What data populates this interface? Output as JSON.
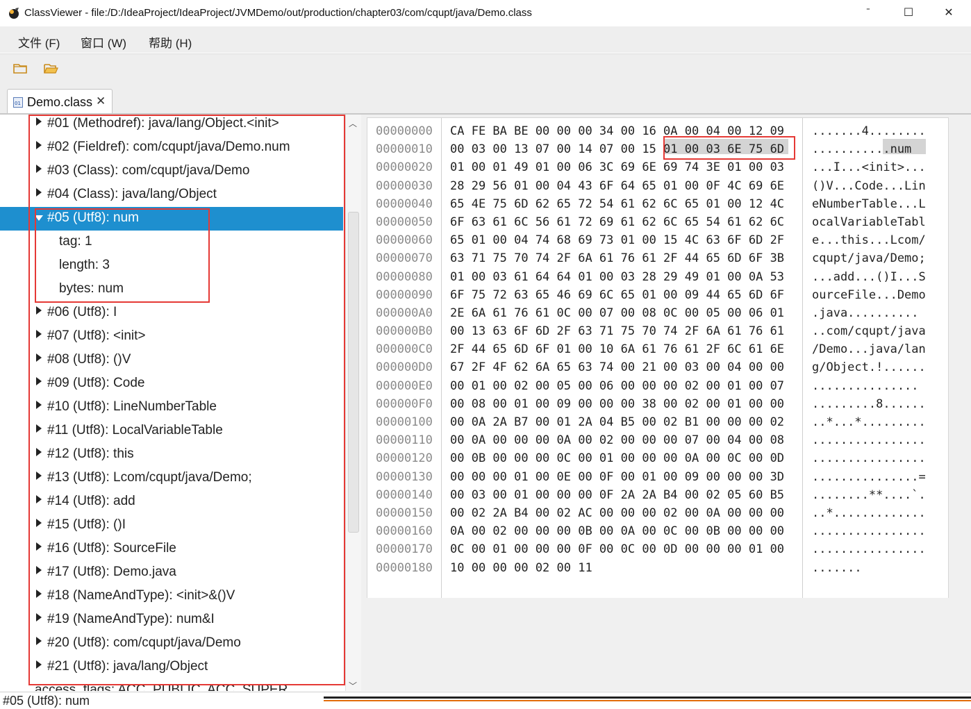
{
  "window": {
    "title": "ClassViewer - file:/D:/IdeaProject/IdeaProject/JVMDemo/out/production/chapter03/com/cqupt/java/Demo.class",
    "minimize": "ˉ",
    "maximize": "☐",
    "close": "✕"
  },
  "menu": [
    "文件 (F)",
    "窗口 (W)",
    "帮助 (H)"
  ],
  "toolbar": {
    "open_icon": "folder-icon",
    "open_recent_icon": "folder-open-icon"
  },
  "tab": {
    "label": "Demo.class",
    "close": "✕"
  },
  "tree": {
    "rows": [
      "#01 (Methodref): java/lang/Object.<init>",
      "#02 (Fieldref): com/cqupt/java/Demo.num",
      "#03 (Class): com/cqupt/java/Demo",
      "#04 (Class): java/lang/Object",
      "#05 (Utf8): num",
      "tag: 1",
      "length: 3",
      "bytes: num",
      "#06 (Utf8): I",
      "#07 (Utf8): <init>",
      "#08 (Utf8): ()V",
      "#09 (Utf8): Code",
      "#10 (Utf8): LineNumberTable",
      "#11 (Utf8): LocalVariableTable",
      "#12 (Utf8): this",
      "#13 (Utf8): Lcom/cqupt/java/Demo;",
      "#14 (Utf8): add",
      "#15 (Utf8): ()I",
      "#16 (Utf8): SourceFile",
      "#17 (Utf8): Demo.java",
      "#18 (NameAndType): <init>&()V",
      "#19 (NameAndType): num&I",
      "#20 (Utf8): com/cqupt/java/Demo",
      "#21 (Utf8): java/lang/Object",
      "access_flags: ACC_PUBLIC, ACC_SUPER"
    ],
    "selected": "#05 (Utf8): num"
  },
  "hex": {
    "addresses": [
      "00000000",
      "00000010",
      "00000020",
      "00000030",
      "00000040",
      "00000050",
      "00000060",
      "00000070",
      "00000080",
      "00000090",
      "000000A0",
      "000000B0",
      "000000C0",
      "000000D0",
      "000000E0",
      "000000F0",
      "00000100",
      "00000110",
      "00000120",
      "00000130",
      "00000140",
      "00000150",
      "00000160",
      "00000170",
      "00000180"
    ],
    "bytes": [
      "CA FE BA BE 00 00 00 34 00 16 0A 00 04 00 12 09",
      "00 03 00 13 07 00 14 07 00 15 01 00 03 6E 75 6D",
      "01 00 01 49 01 00 06 3C 69 6E 69 74 3E 01 00 03",
      "28 29 56 01 00 04 43 6F 64 65 01 00 0F 4C 69 6E",
      "65 4E 75 6D 62 65 72 54 61 62 6C 65 01 00 12 4C",
      "6F 63 61 6C 56 61 72 69 61 62 6C 65 54 61 62 6C",
      "65 01 00 04 74 68 69 73 01 00 15 4C 63 6F 6D 2F",
      "63 71 75 70 74 2F 6A 61 76 61 2F 44 65 6D 6F 3B",
      "01 00 03 61 64 64 01 00 03 28 29 49 01 00 0A 53",
      "6F 75 72 63 65 46 69 6C 65 01 00 09 44 65 6D 6F",
      "2E 6A 61 76 61 0C 00 07 00 08 0C 00 05 00 06 01",
      "00 13 63 6F 6D 2F 63 71 75 70 74 2F 6A 61 76 61",
      "2F 44 65 6D 6F 01 00 10 6A 61 76 61 2F 6C 61 6E",
      "67 2F 4F 62 6A 65 63 74 00 21 00 03 00 04 00 00",
      "00 01 00 02 00 05 00 06 00 00 00 02 00 01 00 07",
      "00 08 00 01 00 09 00 00 00 38 00 02 00 01 00 00",
      "00 0A 2A B7 00 01 2A 04 B5 00 02 B1 00 00 00 02",
      "00 0A 00 00 00 0A 00 02 00 00 00 07 00 04 00 08",
      "00 0B 00 00 00 0C 00 01 00 00 00 0A 00 0C 00 0D",
      "00 00 00 01 00 0E 00 0F 00 01 00 09 00 00 00 3D",
      "00 03 00 01 00 00 00 0F 2A 2A B4 00 02 05 60 B5",
      "00 02 2A B4 00 02 AC 00 00 00 02 00 0A 00 00 00",
      "0A 00 02 00 00 00 0B 00 0A 00 0C 00 0B 00 00 00",
      "0C 00 01 00 00 00 0F 00 0C 00 0D 00 00 00 01 00",
      "10 00 00 00 02 00 11"
    ],
    "ascii": [
      ".......4........",
      "...........num",
      "...I...<init>...",
      "()V...Code...Lin",
      "eNumberTable...L",
      "ocalVariableTabl",
      "e...this...Lcom/",
      "cqupt/java/Demo;",
      "...add...()I...S",
      "ourceFile...Demo",
      ".java..........",
      "..com/cqupt/java",
      "/Demo...java/lan",
      "g/Object.!......",
      "...............",
      ".........8......",
      "..*...*.........",
      "................",
      "................",
      "...............=",
      "........**....`.",
      "..*.............",
      "................",
      "................",
      "......."
    ]
  },
  "status": {
    "text": "#05 (Utf8): num"
  }
}
